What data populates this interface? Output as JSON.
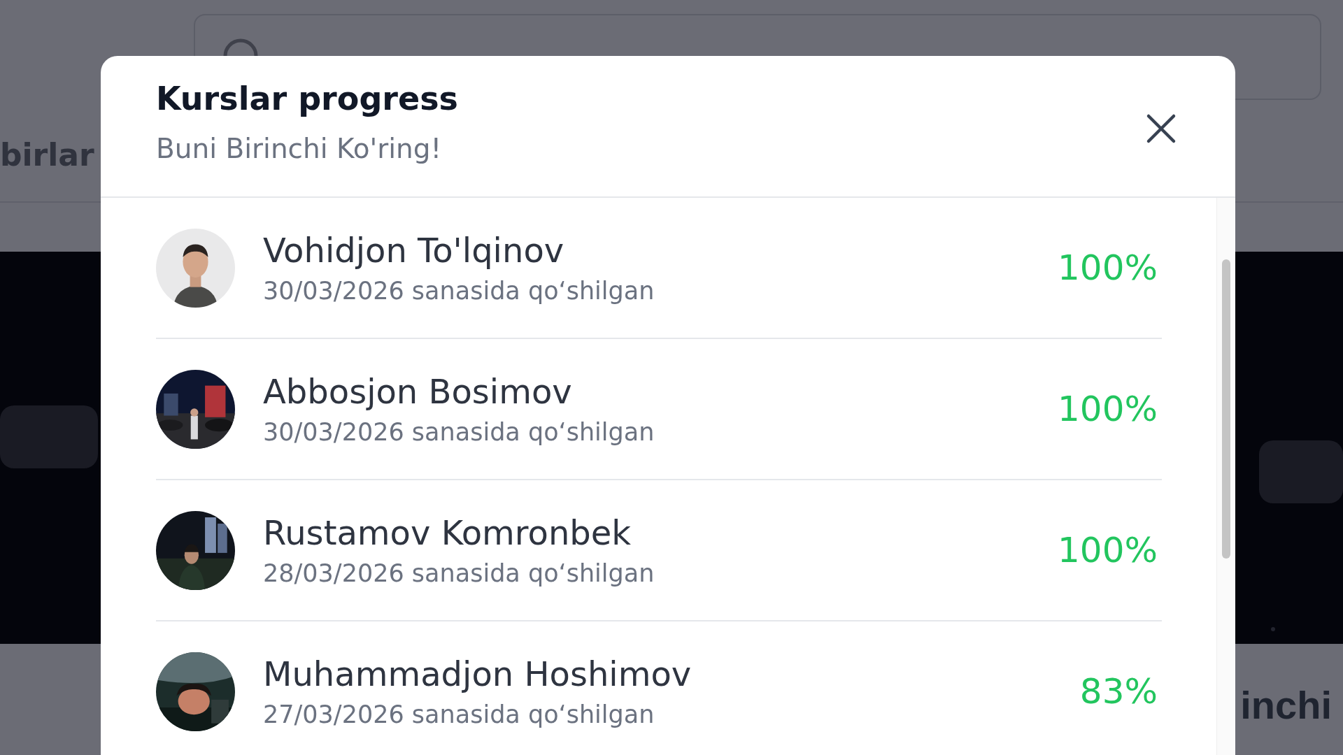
{
  "background": {
    "section_title": "birlar",
    "card_title": "inchi"
  },
  "modal": {
    "title": "Kurslar progress",
    "subtitle": "Buni Birinchi Ko'ring!",
    "students": [
      {
        "name": "Vohidjon To'lqinov",
        "joined": "30/03/2026 sanasida qo‘shilgan",
        "progress": "100%"
      },
      {
        "name": "Abbosjon Bosimov",
        "joined": "30/03/2026 sanasida qo‘shilgan",
        "progress": "100%"
      },
      {
        "name": "Rustamov Komronbek",
        "joined": "28/03/2026 sanasida qo‘shilgan",
        "progress": "100%"
      },
      {
        "name": "Muhammadjon Hoshimov",
        "joined": "27/03/2026 sanasida qo‘shilgan",
        "progress": "83%"
      }
    ]
  }
}
